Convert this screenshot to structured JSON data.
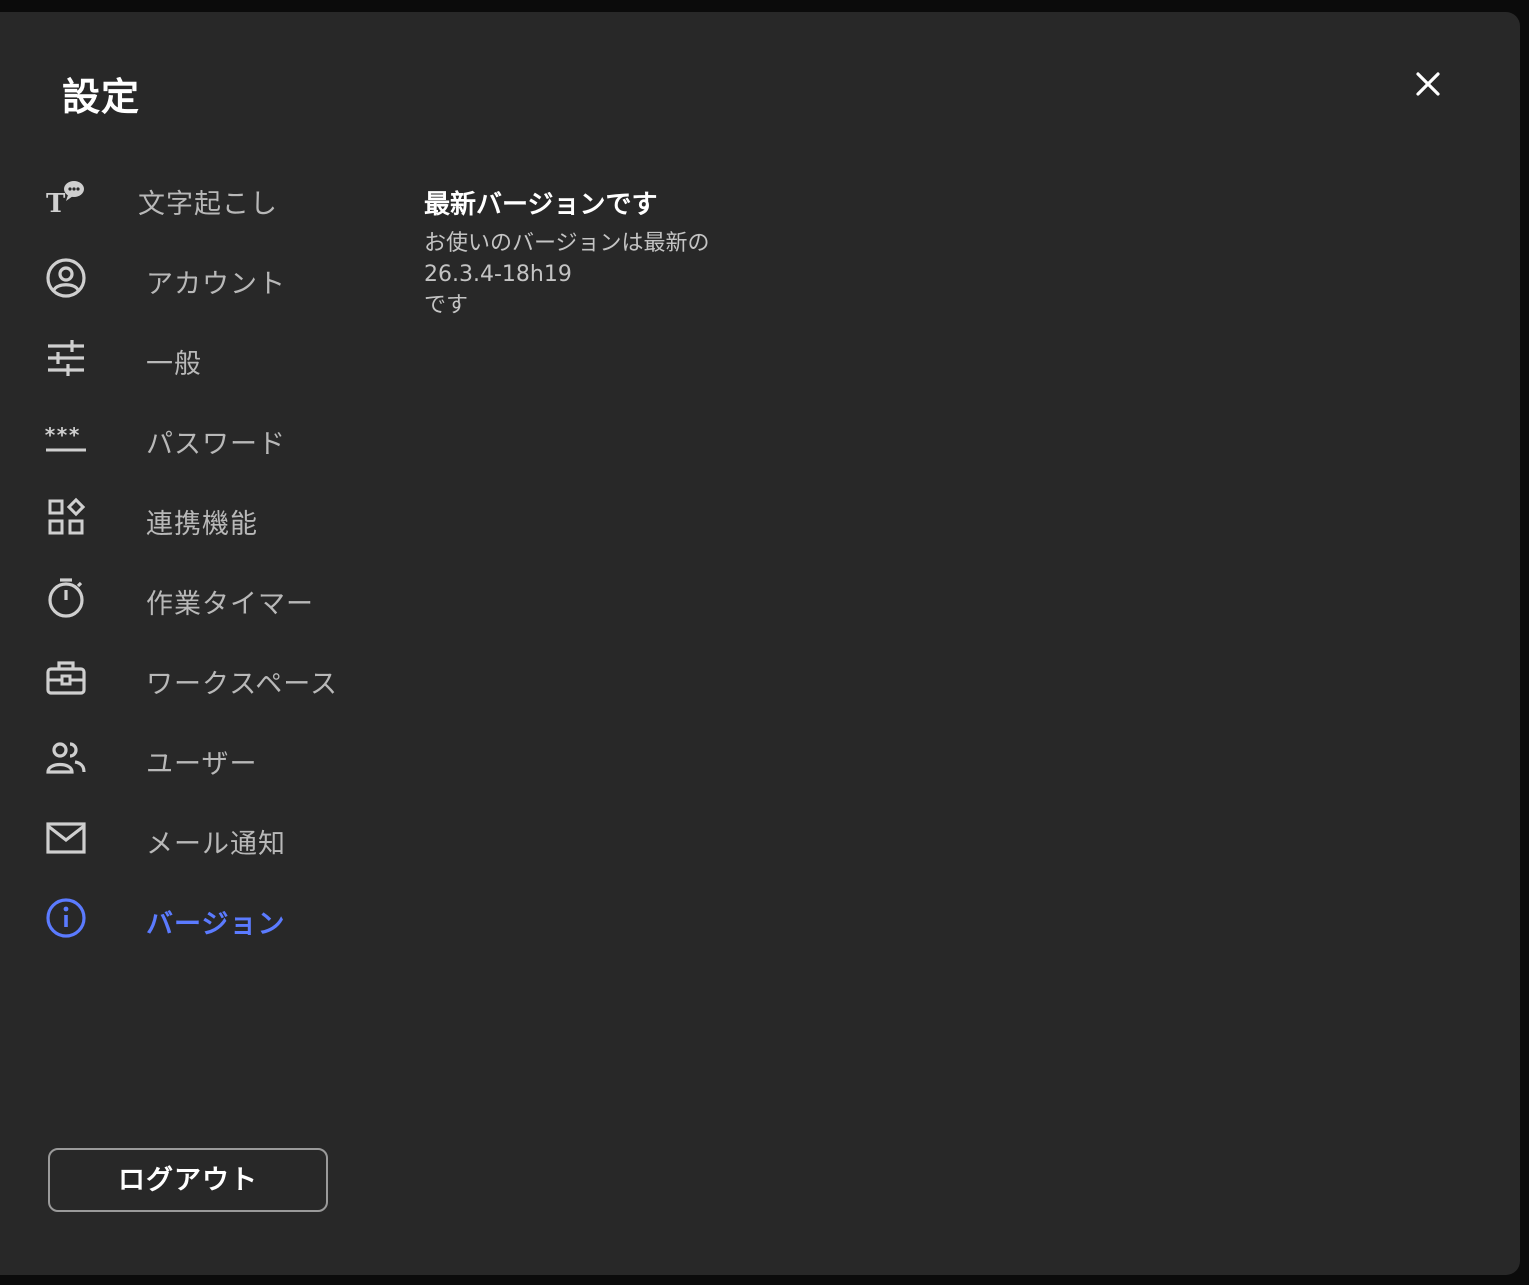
{
  "modal": {
    "title": "設定",
    "close_icon": "close-icon"
  },
  "sidebar": {
    "items": [
      {
        "label": "文字起こし",
        "icon": "transcription-icon",
        "active": false
      },
      {
        "label": "アカウント",
        "icon": "account-icon",
        "active": false
      },
      {
        "label": "一般",
        "icon": "sliders-icon",
        "active": false
      },
      {
        "label": "パスワード",
        "icon": "password-icon",
        "active": false
      },
      {
        "label": "連携機能",
        "icon": "integrations-icon",
        "active": false
      },
      {
        "label": "作業タイマー",
        "icon": "timer-icon",
        "active": false
      },
      {
        "label": "ワークスペース",
        "icon": "briefcase-icon",
        "active": false
      },
      {
        "label": "ユーザー",
        "icon": "users-icon",
        "active": false
      },
      {
        "label": "メール通知",
        "icon": "mail-icon",
        "active": false
      },
      {
        "label": "バージョン",
        "icon": "info-icon",
        "active": true
      }
    ],
    "logout_label": "ログアウト"
  },
  "content": {
    "heading": "最新バージョンです",
    "line1": "お使いのバージョンは最新の",
    "version": "26.3.4-18h19",
    "line3": "です"
  },
  "colors": {
    "background": "#282828",
    "accent": "#5b7bff",
    "text": "#b8b8b8"
  }
}
